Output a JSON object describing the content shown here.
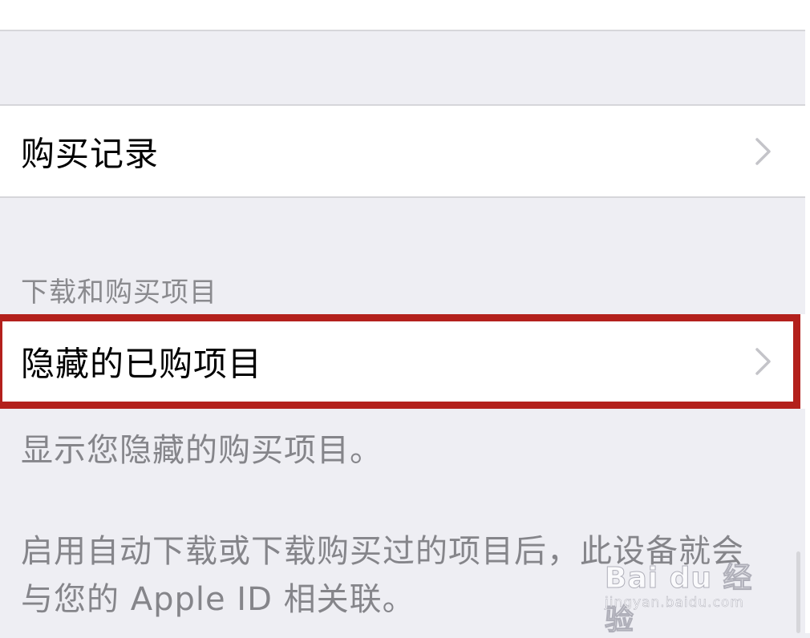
{
  "top_cell": {},
  "purchase_history": {
    "label": "购买记录"
  },
  "downloads_section": {
    "header": "下载和购买项目"
  },
  "hidden_purchases": {
    "label": "隐藏的已购项目"
  },
  "footer": {
    "hidden_description": "显示您隐藏的购买项目。",
    "auto_download_note": "启用自动下载或下载购买过的项目后，此设备就会与您的 Apple ID 相关联。"
  },
  "highlight_color": "#b3201c",
  "watermark": {
    "logo": "Bai du 经验",
    "url": "jingyan.baidu.com"
  },
  "icons": {
    "chevron": "chevron-right-icon",
    "paw": "baidu-paw-icon"
  }
}
